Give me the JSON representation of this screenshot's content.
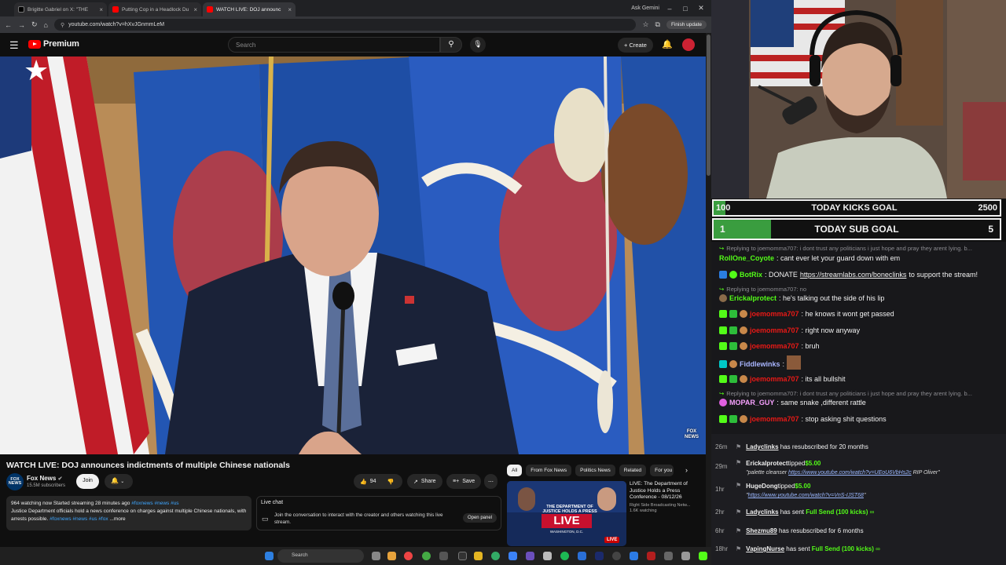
{
  "browser": {
    "tabs": [
      {
        "title": "Brigitte Gabriel on X: \"THE",
        "active": false
      },
      {
        "title": "Putting Cop in a Headlock Du",
        "active": false
      },
      {
        "title": "WATCH LIVE: DOJ announc",
        "active": true
      }
    ],
    "ask_gemini": "Ask Gemini",
    "url": "youtube.com/watch?v=hXvJGnmmLeM",
    "finish_update": "Finish update"
  },
  "youtube": {
    "logo_text": "Premium",
    "search_placeholder": "Search",
    "create_label": "Create",
    "video": {
      "title": "WATCH LIVE: DOJ announces indictments of multiple Chinese nationals",
      "channel": "Fox News",
      "subscribers": "15.5M subscribers",
      "join_label": "Join",
      "likes": "94",
      "share_label": "Share",
      "save_label": "Save",
      "fox_logo": "FOX NEWS"
    },
    "description": {
      "stats": "964 watching now  Started streaming 28 minutes ago",
      "tags_top": "#foxnews #news #us",
      "text": "Justice Department officials hold a news conference on charges against multiple Chinese nationals, with arrests possible.",
      "tags_bottom": "#foxnews #news #us #fox",
      "more": "...more"
    },
    "live_chat": {
      "title": "Live chat",
      "message": "Join the conversation to interact with the creator and others watching this live stream.",
      "open_panel": "Open panel"
    },
    "chips": [
      "All",
      "From Fox News",
      "Politics News",
      "Related",
      "For you"
    ],
    "suggested": {
      "title": "LIVE: The Department of Justice Holds a Press Conference - 08/12/26",
      "channel": "Right Side Broadcasting Netw...",
      "watching": "1.6K watching",
      "thumb_top": "THE DEPARTMENT OF JUSTICE HOLDS A PRESS CONFERENCE",
      "thumb_live": "LIVE",
      "thumb_place": "WASHINGTON, D.C."
    }
  },
  "taskbar": {
    "search": "Search"
  },
  "stream": {
    "kicks_goal": {
      "current": "100",
      "label": "TODAY KICKS GOAL",
      "target": "2500",
      "progress": 0.04
    },
    "sub_goal": {
      "current": "1",
      "label": "TODAY SUB GOAL",
      "target": "5",
      "progress": 0.2
    },
    "chat": [
      {
        "reply": "Replying to joemomma707: i dont trust any politicians i just hope and pray they arent lying. b..."
      },
      {
        "user": "RollOne_Coyote",
        "color": "#53fc18",
        "text": ": cant ever let your guard down with em"
      },
      {
        "user": "BotRix",
        "color": "#53fc18",
        "text": ": DONATE ",
        "link": "https://streamlabs.com/boneclinks",
        "after": " to support the stream!"
      },
      {
        "reply": "Replying to joemomma707: no"
      },
      {
        "user": "Erickalprotect",
        "color": "#53fc18",
        "text": ": he's talking out the side of his lip"
      },
      {
        "user": "joemomma707",
        "color": "#e91916",
        "text": ": he knows it wont get passed"
      },
      {
        "user": "joemomma707",
        "color": "#e91916",
        "text": ": right now anyway"
      },
      {
        "user": "joemomma707",
        "color": "#e91916",
        "text": ": bruh"
      },
      {
        "user": "Fiddlewinks",
        "color": "#a9b6ff",
        "text": ":"
      },
      {
        "user": "joemomma707",
        "color": "#e91916",
        "text": ": its all bullshit"
      },
      {
        "reply": "Replying to joemomma707: i dont trust any politicians i just hope and pray they arent lying. b..."
      },
      {
        "user": "MOPAR_GUY",
        "color": "#f7a1ff",
        "text": ": same snake ,different rattle"
      },
      {
        "user": "joemomma707",
        "color": "#e91916",
        "text": ": stop asking shit questions"
      }
    ],
    "activity": [
      {
        "time": "26m",
        "user": "Ladyclinks",
        "text": " has resubscribed for 20 months"
      },
      {
        "time": "29m",
        "user": "Erickalprotect",
        "text": "tipped",
        "amount": "$5.00",
        "quote": "\"palette cleanser ",
        "link": "https://www.youtube.com/watch?v=UEoU6VbHs2c",
        "tail": " RIP Oliver\""
      },
      {
        "time": "1hr",
        "user": "HugeDong",
        "text": "tipped",
        "amount": "$5.00",
        "quote": "\"",
        "link": "https://www.youtube.com/watch?v=VnS-IJST68",
        "tail": "\""
      },
      {
        "time": "2hr",
        "user": "Ladyclinks",
        "text": " has sent ",
        "gift": "Full Send (100 kicks)"
      },
      {
        "time": "6hr",
        "user": "Shezmu89",
        "text": " has resubscribed for 6 months"
      },
      {
        "time": "18hr",
        "user": "VapingNurse",
        "text": " has sent ",
        "gift": "Full Send (100 kicks)"
      }
    ]
  },
  "colors": {
    "accent_green": "#53fc18",
    "yt_red": "#ff0000",
    "goal_fill": "#3a9d3f"
  }
}
